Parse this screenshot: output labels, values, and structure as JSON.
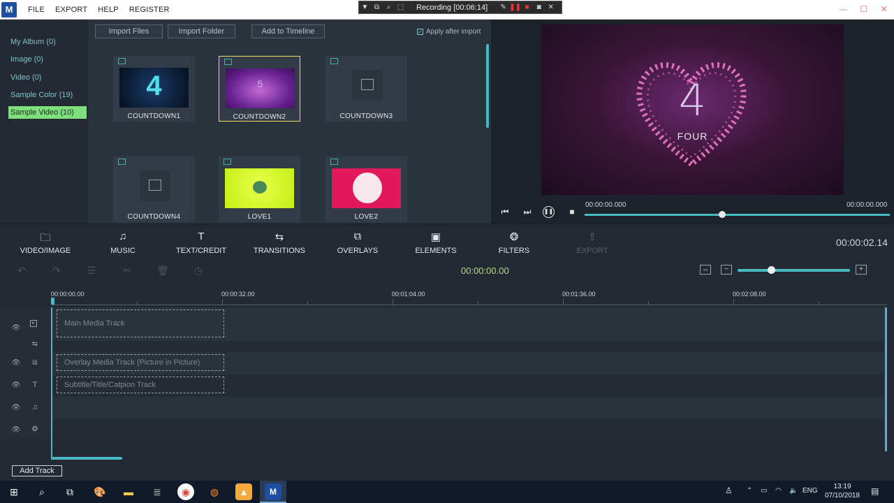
{
  "menu": {
    "file": "FILE",
    "export": "EXPORT",
    "help": "HELP",
    "register": "REGISTER"
  },
  "recording": {
    "label": "Recording [00:06:14]"
  },
  "sidebar": {
    "items": [
      {
        "label": "My Album (0)"
      },
      {
        "label": "Image (0)"
      },
      {
        "label": "Video (0)"
      },
      {
        "label": "Sample Color (19)"
      },
      {
        "label": "Sample Video (10)",
        "active": true
      }
    ]
  },
  "media": {
    "import_files": "Import Files",
    "import_folder": "Import Folder",
    "add_to_timeline": "Add to Timeline",
    "apply_after_import": "Apply after import",
    "apply_checked": true,
    "clips": [
      {
        "name": "COUNTDOWN1"
      },
      {
        "name": "COUNTDOWN2",
        "selected": true
      },
      {
        "name": "COUNTDOWN3"
      },
      {
        "name": "COUNTDOWN4"
      },
      {
        "name": "LOVE1"
      },
      {
        "name": "LOVE2"
      }
    ]
  },
  "preview": {
    "big_number": "4",
    "big_word": "FOUR",
    "time_current": "00:00:00.000",
    "time_total": "00:00:00.000",
    "progress": 0.45
  },
  "toolbar": {
    "tabs": [
      {
        "label": "VIDEO/IMAGE",
        "icon": "folder-icon"
      },
      {
        "label": "MUSIC",
        "icon": "music-note-icon"
      },
      {
        "label": "TEXT/CREDIT",
        "icon": "text-icon"
      },
      {
        "label": "TRANSITIONS",
        "icon": "transitions-icon"
      },
      {
        "label": "OVERLAYS",
        "icon": "overlays-icon"
      },
      {
        "label": "ELEMENTS",
        "icon": "image-icon"
      },
      {
        "label": "FILTERS",
        "icon": "filters-icon"
      },
      {
        "label": "EXPORT",
        "icon": "export-icon",
        "disabled": true
      }
    ],
    "duration": "00:00:02.14"
  },
  "editbar": {
    "timecode": "00:00:00.00",
    "zoom_level": 0.3
  },
  "ruler": {
    "marks": [
      "00:00:00.00",
      "00:00:32.00",
      "00:01:04.00",
      "00:01:36.00",
      "00:02:08.00"
    ]
  },
  "tracks": {
    "main": "Main Media Track",
    "overlay": "Overlay Media Track (Picture in Picture)",
    "subtitle": "Subtitle/Title/Catpion Track"
  },
  "add_track": "Add Track",
  "taskbar": {
    "language": "ENG",
    "time": "13:19",
    "date": "07/10/2018"
  },
  "colors": {
    "accent": "#49b9c4",
    "active_green": "#7ee07c",
    "timecode": "#b9d88a"
  }
}
